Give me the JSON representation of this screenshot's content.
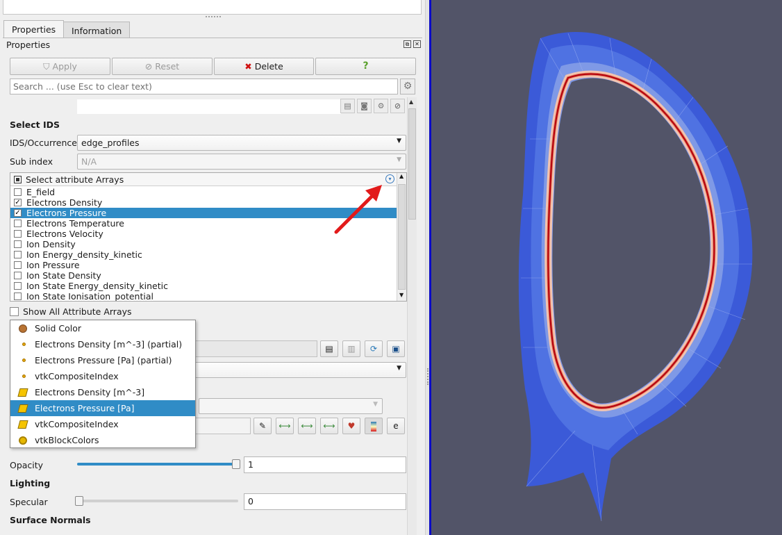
{
  "tabs": [
    {
      "label": "Properties",
      "active": true
    },
    {
      "label": "Information",
      "active": false
    }
  ],
  "panel_title": "Properties",
  "buttons": {
    "apply": "Apply",
    "reset": "Reset",
    "delete": "Delete",
    "help": "?"
  },
  "search": {
    "placeholder": "Search ... (use Esc to clear text)"
  },
  "select_ids": {
    "section": "Select IDS",
    "ids_label": "IDS/Occurrence",
    "ids_value": "edge_profiles",
    "sub_index_label": "Sub index",
    "sub_index_value": "N/A"
  },
  "attributes": {
    "header": "Select attribute Arrays",
    "rows": [
      {
        "label": "E_field",
        "checked": false,
        "selected": false
      },
      {
        "label": "Electrons Density",
        "checked": true,
        "selected": false
      },
      {
        "label": "Electrons Pressure",
        "checked": true,
        "selected": true
      },
      {
        "label": "Electrons Temperature",
        "checked": false,
        "selected": false
      },
      {
        "label": "Electrons Velocity",
        "checked": false,
        "selected": false
      },
      {
        "label": "Ion Density",
        "checked": false,
        "selected": false
      },
      {
        "label": "Ion Energy_density_kinetic",
        "checked": false,
        "selected": false
      },
      {
        "label": "Ion Pressure",
        "checked": false,
        "selected": false
      },
      {
        "label": "Ion State Density",
        "checked": false,
        "selected": false
      },
      {
        "label": "Ion State Energy_density_kinetic",
        "checked": false,
        "selected": false
      },
      {
        "label": "Ion State Ionisation_potential",
        "checked": false,
        "selected": false
      }
    ],
    "show_all": "Show All Attribute Arrays"
  },
  "color_popup": {
    "items": [
      {
        "label": "Solid Color",
        "icon": "solid-color-icon",
        "selected": false
      },
      {
        "label": "Electrons Density [m^-3] (partial)",
        "icon": "point-data-icon",
        "selected": false
      },
      {
        "label": "Electrons Pressure [Pa] (partial)",
        "icon": "point-data-icon",
        "selected": false
      },
      {
        "label": "vtkCompositeIndex",
        "icon": "point-data-icon",
        "selected": false
      },
      {
        "label": "Electrons Density [m^-3]",
        "icon": "cell-data-icon",
        "selected": false
      },
      {
        "label": "Electrons Pressure [Pa]",
        "icon": "cell-data-icon",
        "selected": true
      },
      {
        "label": "vtkCompositeIndex",
        "icon": "cell-data-icon",
        "selected": false
      },
      {
        "label": "vtkBlockColors",
        "icon": "block-colors-icon",
        "selected": false
      }
    ]
  },
  "styling": {
    "opacity_label": "Opacity",
    "opacity_value": "1",
    "opacity_level": 1.0,
    "lighting_section": "Lighting",
    "specular_label": "Specular",
    "specular_value": "0",
    "specular_level": 0.0,
    "surface_normals_section": "Surface Normals"
  },
  "colors": {
    "selection": "#308cc6",
    "viewport_bg": "#525468",
    "delete_icon": "#d01010",
    "help_icon": "#5aa02c"
  }
}
